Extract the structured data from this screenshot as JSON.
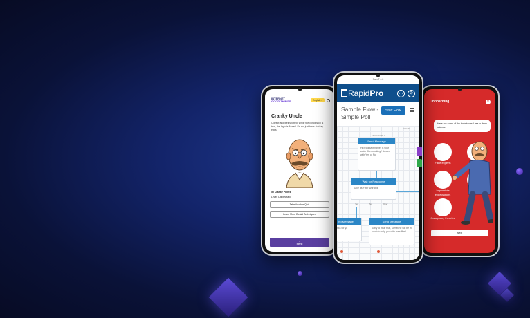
{
  "background": {
    "accent": "#1f3a8f",
    "dark": "#070b24",
    "gem": "#5b4bd6"
  },
  "left_phone": {
    "logo_line1": "INTERNET",
    "logo_line2": "GOOD THINGS",
    "language": "English ▾",
    "title": "Cranky Uncle",
    "body": "Correct and well spotted! While the conclusion is true, the logic is flawed. It's not just birds that lay eggs.",
    "points": "50 Cranky Points",
    "level": "Level: Displeased",
    "buttons": [
      "Take Another Quiz",
      "Learn More Denial Techniques"
    ],
    "menu_label": "Menu",
    "menu_icon": "≡"
  },
  "mid_phone": {
    "status": "9am  T 4.2",
    "logo_rapid": "Rapid",
    "logo_pro": "Pro",
    "title": "Sample Flow - Simple Poll",
    "start_button": "Start Flow",
    "default_label": "Default",
    "node_send_header": "Send Message",
    "flow_start": "FLOW START",
    "node_send_body": "Hi @contact.name, is your water filter working? Answer with Yes or No",
    "wait_header": "Wait for Response",
    "wait_body": "Save as Filter Working",
    "branches": [
      "Yes",
      "No",
      "Other"
    ],
    "left_send_header": "nd Message",
    "left_send_body": "Thanks for yo",
    "right_send_header": "Send Message",
    "right_send_body": "Sorry to hear that, someone will be in touch to help you with your filter!"
  },
  "right_phone": {
    "header": "Onboarding",
    "bubble": "Here are some of the techniques I use to deny science:",
    "labels": [
      "Fake experts",
      "logical fallacies",
      "Impossible expectations",
      "ry picking",
      "Conspiracy theories"
    ],
    "next": "Next",
    "accent": "#d62a2a"
  }
}
